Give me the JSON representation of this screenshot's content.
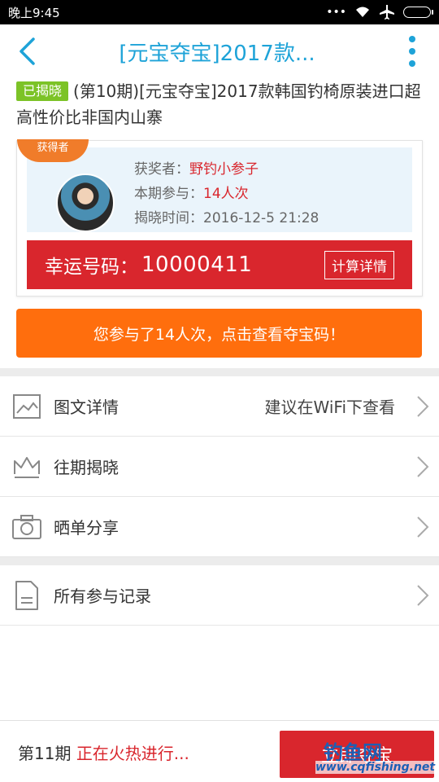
{
  "status_bar": {
    "time": "晚上9:45",
    "icons": [
      "more-dots-icon",
      "wifi-icon",
      "airplane-icon",
      "battery-icon"
    ]
  },
  "header": {
    "title": "[元宝夺宝]2017款...",
    "title_color": "#1ea3d8"
  },
  "product": {
    "badge": "已揭晓",
    "title": "(第10期)[元宝夺宝]2017款韩国钓椅原装进口超高性价比非国内山寨"
  },
  "winner": {
    "ribbon": "获得者",
    "winner_label": "获奖者：",
    "winner_name": "野钓小参子",
    "participate_label": "本期参与：",
    "participate_count": "14人次",
    "reveal_label": "揭晓时间：",
    "reveal_time": "2016-12-5 21:28",
    "lucky_label": "幸运号码：",
    "lucky_number": "10000411",
    "calc_button": "计算详情"
  },
  "participate_button": "您参与了14人次，点击查看夺宝码！",
  "menu": [
    {
      "label": "图文详情",
      "hint": "建议在WiFi下查看",
      "icon": "image-icon"
    },
    {
      "label": "往期揭晓",
      "hint": "",
      "icon": "crown-icon"
    },
    {
      "label": "晒单分享",
      "hint": "",
      "icon": "camera-icon"
    },
    {
      "label": "所有参与记录",
      "hint": "",
      "icon": "document-icon"
    }
  ],
  "bottom": {
    "period": "第11期",
    "status": "正在火热进行...",
    "join_button": "立即夺宝"
  },
  "watermark": {
    "top": "钓鱼网",
    "url": "www.cqfishing.net"
  },
  "colors": {
    "accent_blue": "#1ea3d8",
    "red": "#d9262d",
    "orange": "#ff6e0d",
    "green_badge": "#7cc327"
  }
}
